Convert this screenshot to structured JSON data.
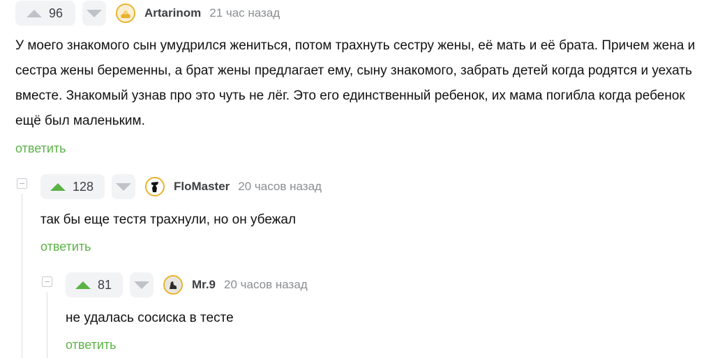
{
  "comments": [
    {
      "score": "96",
      "author": "Artarinom",
      "time": "21 час назад",
      "text": "У моего знакомого сын умудрился жениться, потом трахнуть сестру жены, её мать и её брата. Причем жена и сестра жены беременны, а брат жены предлагает ему, сыну знакомого, забрать детей когда родятся и уехать вместе. Знакомый узнав про это чуть не лёг. Это его единственный ребенок, их мама погибла когда ребенок ещё был маленьким.",
      "reply_label": "ответить"
    },
    {
      "score": "128",
      "author": "FloMaster",
      "time": "20 часов назад",
      "text": "так бы еще тестя трахнули, но он убежал",
      "reply_label": "ответить"
    },
    {
      "score": "81",
      "author": "Mr.9",
      "time": "20 часов назад",
      "text": "не удалась сосиска в тесте",
      "reply_label": "ответить"
    }
  ],
  "colors": {
    "accent": "#5bb346",
    "neutral_arrow": "#bfc3c8",
    "vote_bg": "#f2f3f5",
    "muted_text": "#8a8d91",
    "author_text": "#3d3f42",
    "avatar_ring": "#e9b22b"
  },
  "icons": {
    "upvote": "triangle-up-icon",
    "downvote": "triangle-down-icon",
    "collapse": "minus-box-icon"
  }
}
